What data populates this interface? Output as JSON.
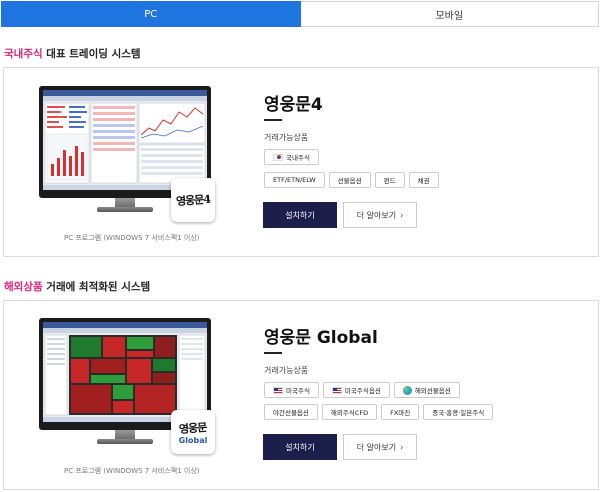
{
  "tabs": [
    {
      "label": "PC",
      "active": true
    },
    {
      "label": "모바일",
      "active": false
    }
  ],
  "sections": [
    {
      "heading_accent": "국내주식",
      "heading_rest": " 대표 트레이딩 시스템",
      "product_title": "영웅문4",
      "logo_text": "영웅문4",
      "products_label": "거래가능상품",
      "chips_row1": [
        {
          "label": "국내주식",
          "flag": "kr"
        }
      ],
      "chips_row2": [
        {
          "label": "ETF/ETN/ELW"
        },
        {
          "label": "선물옵션"
        },
        {
          "label": "펀드"
        },
        {
          "label": "채권"
        }
      ],
      "install_label": "설치하기",
      "more_label": "더 알아보기",
      "caption": "PC 프로그램 (WINDOWS 7 서비스팩1 이상)"
    },
    {
      "heading_accent": "해외상품",
      "heading_rest": " 거래에 최적화된 시스템",
      "product_title": "영웅문 Global",
      "logo_text": "영웅문",
      "logo_sub": "Global",
      "products_label": "거래가능상품",
      "chips_row1": [
        {
          "label": "미국주식",
          "flag": "us"
        },
        {
          "label": "미국주식옵션",
          "flag": "us"
        },
        {
          "label": "해외선물옵션",
          "flag": "globe"
        }
      ],
      "chips_row2": [
        {
          "label": "야간선물옵션"
        },
        {
          "label": "해외주식CFD"
        },
        {
          "label": "FX마진"
        },
        {
          "label": "중국·홍콩·일본주식"
        }
      ],
      "install_label": "설치하기",
      "more_label": "더 알아보기",
      "caption": "PC 프로그램 (WINDOWS 7 서비스팩1 이상)"
    }
  ],
  "colors": {
    "tab_active": "#1f75e0",
    "accent": "#d6247a",
    "install_button": "#1c1f4c"
  }
}
